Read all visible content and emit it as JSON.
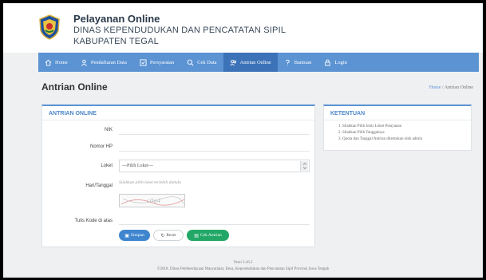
{
  "header": {
    "title": "Pelayanan Online",
    "subtitle1": "DINAS KEPENDUDUKAN DAN PENCATATAN SIPIL",
    "subtitle2": "KABUPATEN TEGAL"
  },
  "nav": {
    "items": [
      {
        "label": "Home",
        "icon": "home-icon"
      },
      {
        "label": "Pendaftaran Data",
        "icon": "user-icon"
      },
      {
        "label": "Persyaratan",
        "icon": "checklist-icon"
      },
      {
        "label": "Cek Data",
        "icon": "search-icon"
      },
      {
        "label": "Antrian Online",
        "icon": "users-icon",
        "active": true
      },
      {
        "label": "Bantuan",
        "icon": "question-icon"
      },
      {
        "label": "Login",
        "icon": "lock-icon"
      }
    ],
    "color": "#5b93d3",
    "active_color": "#3c72b8"
  },
  "page": {
    "title": "Antrian Online",
    "breadcrumb_home": "Home",
    "breadcrumb_sep": "/",
    "breadcrumb_current": "Antrian Online"
  },
  "form": {
    "heading": "ANTRIAN ONLINE",
    "nik_label": "NIK",
    "nik_value": "",
    "hp_label": "Nomor HP",
    "hp_value": "",
    "loket_label": "Loket",
    "loket_selected": "---Pilih Loket---",
    "tanggal_label": "Hari/Tanggal",
    "tanggal_hint": "Silahkan pilih loket terlebih dahulu",
    "captcha_text": "c0g4",
    "kode_label": "Tulis Kode di atas",
    "kode_value": "",
    "save_label": "Simpan",
    "reset_label": "Reset",
    "print_label": "Cek Antrian"
  },
  "rules": {
    "heading": "KETENTUAN",
    "items": [
      "1. Silahkan Pilih Jenis Loket Pelayanan",
      "2. Silahkan Pilih Tanggalnya",
      "3. Quota dan Tanggal Antrian ditentukan oleh admin"
    ]
  },
  "footer": {
    "version": "Versi 3.16.2",
    "copyright": "©2018. Dinas Pemberdayaan Masyarakat, Desa, Kependudukan dan Pencatatan Sipil Provinsi Jawa Tengah"
  }
}
